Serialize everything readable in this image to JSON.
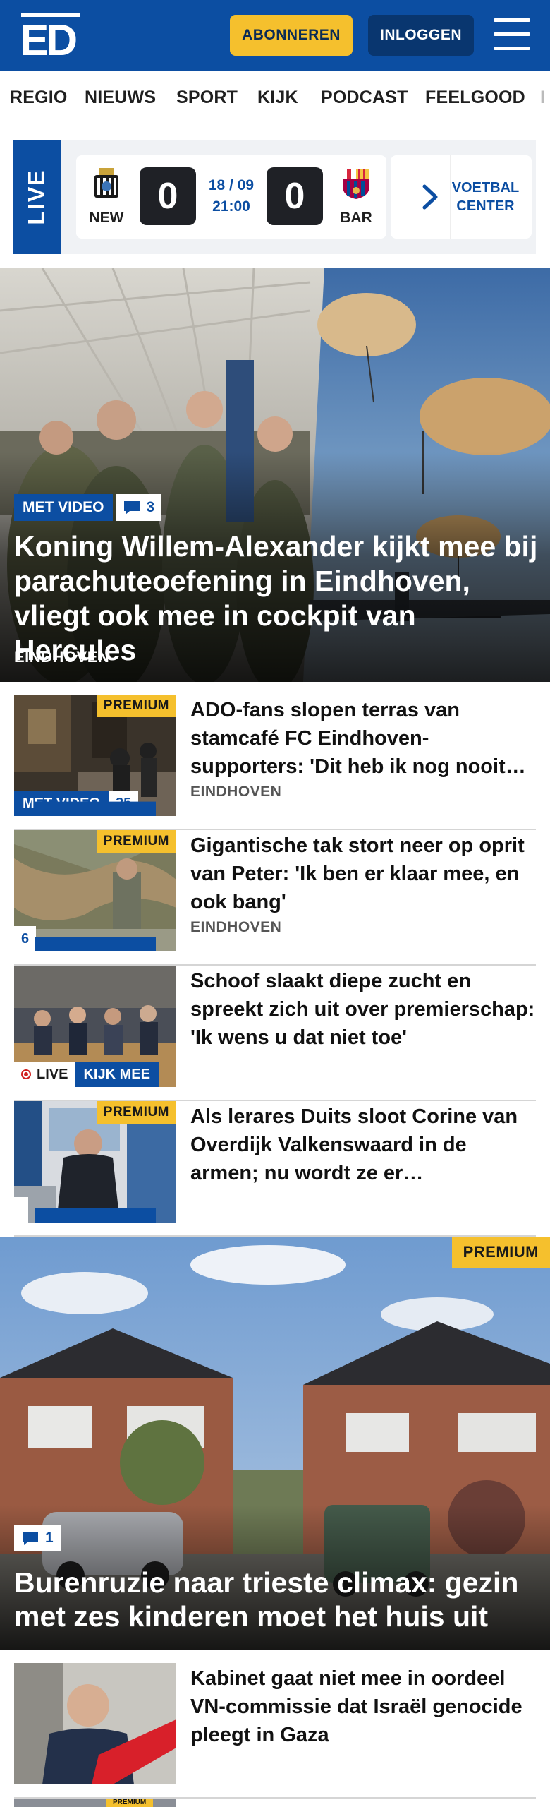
{
  "header": {
    "logo_text": "ED",
    "subscribe_label": "ABONNEREN",
    "login_label": "INLOGGEN",
    "menu_icon": "hamburger-icon"
  },
  "nav": {
    "items": [
      "REGIO",
      "NIEUWS",
      "SPORT",
      "KIJK",
      "PODCAST",
      "FEELGOOD",
      "I"
    ]
  },
  "live": {
    "label": "LIVE",
    "home_team": "NEW",
    "home_score": "0",
    "away_team": "BAR",
    "away_score": "0",
    "date": "18 / 09",
    "time": "21:00",
    "center_label_1": "VOETBAL",
    "center_label_2": "CENTER"
  },
  "hero": {
    "video_label": "MET VIDEO",
    "comments": "3",
    "title": "Koning Willem-Alexander kijkt mee bij parachuteoefening in Eindhoven, vliegt ook mee in cockpit van Hercules",
    "tag": "EINDHOVEN"
  },
  "articles": [
    {
      "premium": "PREMIUM",
      "video_label": "MET VIDEO",
      "comments": "25",
      "title": "ADO-fans slopen terras van stamcafé FC Eindhoven-supporters: 'Dit heb ik nog nooit…",
      "tag": "EINDHOVEN"
    },
    {
      "premium": "PREMIUM",
      "comments": "6",
      "title": "Gigantische tak stort neer op oprit van Peter: 'Ik ben er klaar mee, en ook bang'",
      "tag": "EINDHOVEN"
    },
    {
      "live_label": "LIVE",
      "watch_label": "KIJK MEE",
      "title": "Schoof slaakt diepe zucht en spreekt zich uit over premier­schap: 'Ik wens u dat niet toe'"
    },
    {
      "premium": "PREMIUM",
      "title": "Als lerares Duits sloot Corine van Overdijk Valkenswaard in de armen; nu wordt ze er…"
    }
  ],
  "hero2": {
    "premium": "PREMIUM",
    "comments": "1",
    "title": "Burenruzie naar trieste climax: gezin met zes kinderen moet het huis uit"
  },
  "article_bottom": {
    "title": "Kabinet gaat niet mee in oordeel VN-commissie dat Israël genocide pleegt in Gaza",
    "next_premium": "PREMIUM"
  },
  "colors": {
    "brand_blue": "#0c4ea2",
    "accent_yellow": "#f5c02d",
    "dark_blue": "#09366f"
  }
}
